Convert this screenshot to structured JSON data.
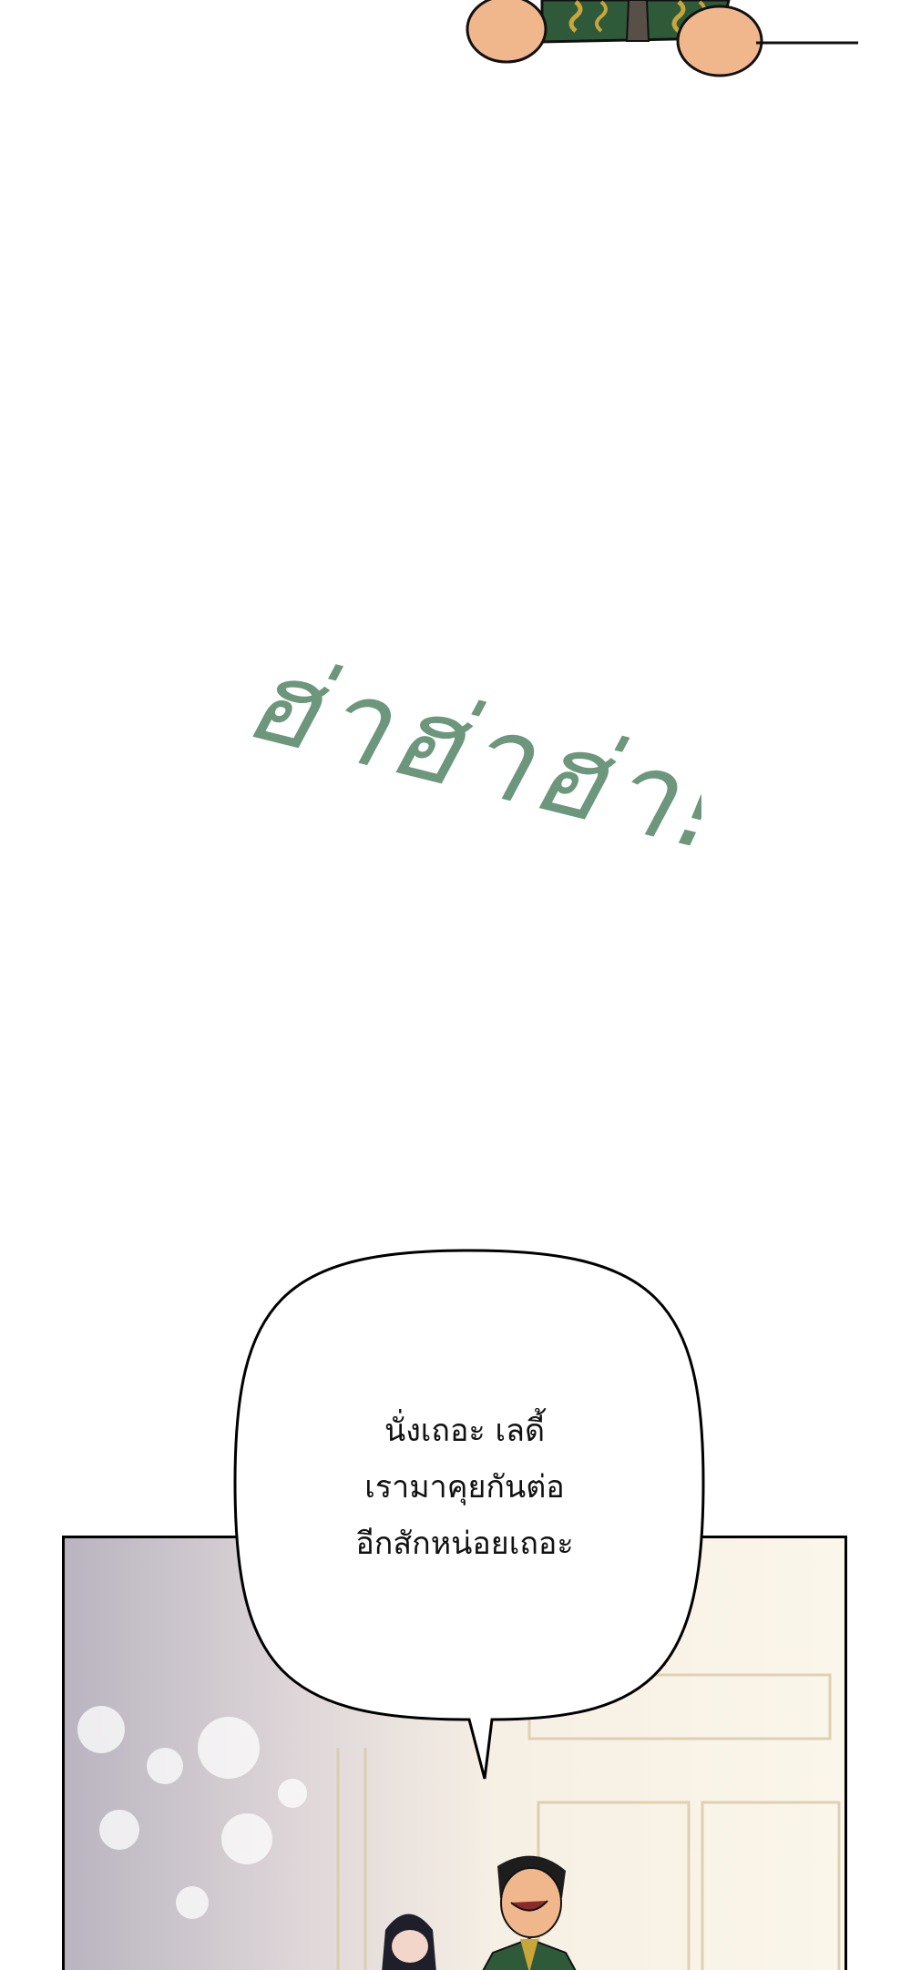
{
  "sound_effect": {
    "text": "ฮ่าฮ่าฮ่า!",
    "color": "#6d977c"
  },
  "speech_bubble": {
    "lines": [
      "นั่งเถอะ เลดี้",
      "เรามาคุยกันต่อ",
      "อีกสักหน่อยเถอะ"
    ]
  },
  "colors": {
    "outfit_green": "#2f5a3a",
    "gold_trim": "#c8a63a",
    "skin": "#f0b78d",
    "panel_border": "#000000"
  }
}
